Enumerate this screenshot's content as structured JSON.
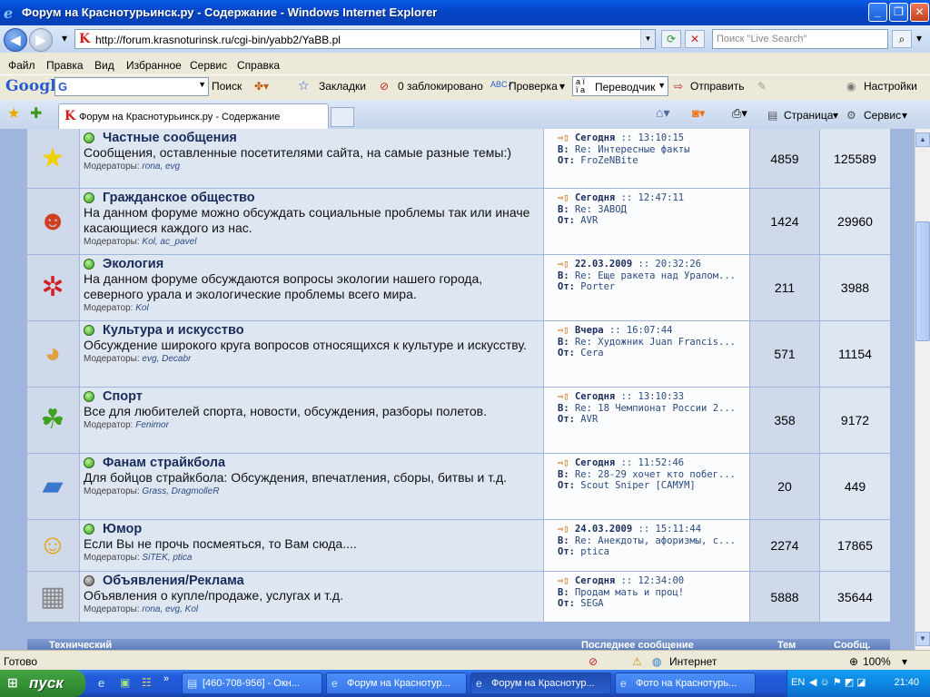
{
  "window": {
    "title": "Форум на Краснотурьинск.ру - Содержание - Windows Internet Explorer"
  },
  "address": {
    "url": "http://forum.krasnoturinsk.ru/cgi-bin/yabb2/YaBB.pl",
    "search_placeholder": "Поиск \"Live Search\""
  },
  "menu": [
    "Файл",
    "Правка",
    "Вид",
    "Избранное",
    "Сервис",
    "Справка"
  ],
  "google_toolbar": {
    "logo": "Google",
    "search_label": "Поиск",
    "bookmarks": "Закладки",
    "blocked": "0 заблокировано",
    "spellcheck": "Проверка",
    "translator": "Переводчик",
    "send": "Отправить",
    "settings": "Настройки"
  },
  "tabs": {
    "active_tab": "Форум на Краснотурьинск.ру - Содержание",
    "page_label": "Страница",
    "service_label": "Сервис"
  },
  "forums": [
    {
      "icon": "star-icon",
      "title": "Частные сообщения",
      "desc": "Сообщения, оставленные посетителями сайта, на самые разные темы:)",
      "mods_label": "Модераторы:",
      "mods": "rona, evg",
      "date": "Сегодня",
      "time": ":: 13:10:15",
      "in": "Re: Интересные факты",
      "from": "FroZeNBite",
      "topics": "4859",
      "posts": "125589",
      "status": "new"
    },
    {
      "icon": "people-icon",
      "title": "Гражданское общество",
      "desc": "На данном форуме можно обсуждать социальные проблемы так или иначе касающиеся каждого из нас.",
      "mods_label": "Модераторы:",
      "mods": "Kol, ac_pavel",
      "date": "Сегодня",
      "time": ":: 12:47:11",
      "in": "Re: ЗАВОД",
      "from": "AVR",
      "topics": "1424",
      "posts": "29960",
      "status": "new"
    },
    {
      "icon": "ladybug-icon",
      "title": "Экология",
      "desc": "На данном форуме обсуждаются вопросы экологии нашего города, северного урала и экологические проблемы всего мира.",
      "mods_label": "Модератор:",
      "mods": "Kol",
      "date": "22.03.2009",
      "time": ":: 20:32:26",
      "in": "Re: Еще ракета над Уралом...",
      "from": "Porter",
      "topics": "211",
      "posts": "3988",
      "status": "new"
    },
    {
      "icon": "palette-icon",
      "title": "Культура и искусство",
      "desc": "Обсуждение широкого круга вопросов относящихся к культуре и искусству.",
      "mods_label": "Модераторы:",
      "mods": "evg, Decabr",
      "date": "Вчера",
      "time": ":: 16:07:44",
      "in": "Re: Художник Juan Francis...",
      "from": "Cera",
      "topics": "571",
      "posts": "11154",
      "status": "new"
    },
    {
      "icon": "runner-icon",
      "title": "Спорт",
      "desc": "Все для любителей спорта, новости, обсуждения, разборы полетов.",
      "mods_label": "Модератор:",
      "mods": "Fenimor",
      "date": "Сегодня",
      "time": ":: 13:10:33",
      "in": "Re: 18 Чемпионат России 2...",
      "from": "AVR",
      "topics": "358",
      "posts": "9172",
      "status": "new"
    },
    {
      "icon": "folder-icon",
      "title": "Фанам страйкбола",
      "desc": "Для бойцов страйкбола: Обсуждения, впечатления, сборы, битвы и т.д.",
      "mods_label": "Модераторы:",
      "mods": "Grass, DragmolleR",
      "date": "Сегодня",
      "time": ":: 11:52:46",
      "in": "Re: 28-29 хочет кто побег...",
      "from": "Scout Sniper [САМУМ]",
      "topics": "20",
      "posts": "449",
      "status": "new"
    },
    {
      "icon": "smiley-icon",
      "title": "Юмор",
      "desc": "Если Вы не прочь посмеяться, то Вам сюда....",
      "mods_label": "Модераторы:",
      "mods": "SiTEK, ptica",
      "date": "24.03.2009",
      "time": ":: 15:11:44",
      "in": "Re: Анекдоты, афоризмы, с...",
      "from": "ptica",
      "topics": "2274",
      "posts": "17865",
      "status": "new"
    },
    {
      "icon": "billboard-icon",
      "title": "Объявления/Реклама",
      "desc": "Объявления о купле/продаже, услугах и т.д.",
      "mods_label": "Модераторы:",
      "mods": "rona, evg, Kol",
      "date": "Сегодня",
      "time": ":: 12:34:00",
      "in": "Продам мать и проц!",
      "from": "SEGA",
      "topics": "5888",
      "posts": "35644",
      "status": "old"
    }
  ],
  "labels": {
    "in": "В:",
    "from": "От:"
  },
  "footer_header": {
    "category": "Технический",
    "last_post": "Последнее сообщение",
    "topics": "Тем",
    "posts": "Сообщ."
  },
  "status": {
    "text": "Готово",
    "zone": "Интернет",
    "zoom": "100%"
  },
  "taskbar": {
    "start": "пуск",
    "tasks": [
      "[460-708-956] - Окн...",
      "Форум на Краснотур...",
      "Форум на Краснотур...",
      "Фото на Краснотурь..."
    ],
    "lang": "EN",
    "clock": "21:40"
  }
}
